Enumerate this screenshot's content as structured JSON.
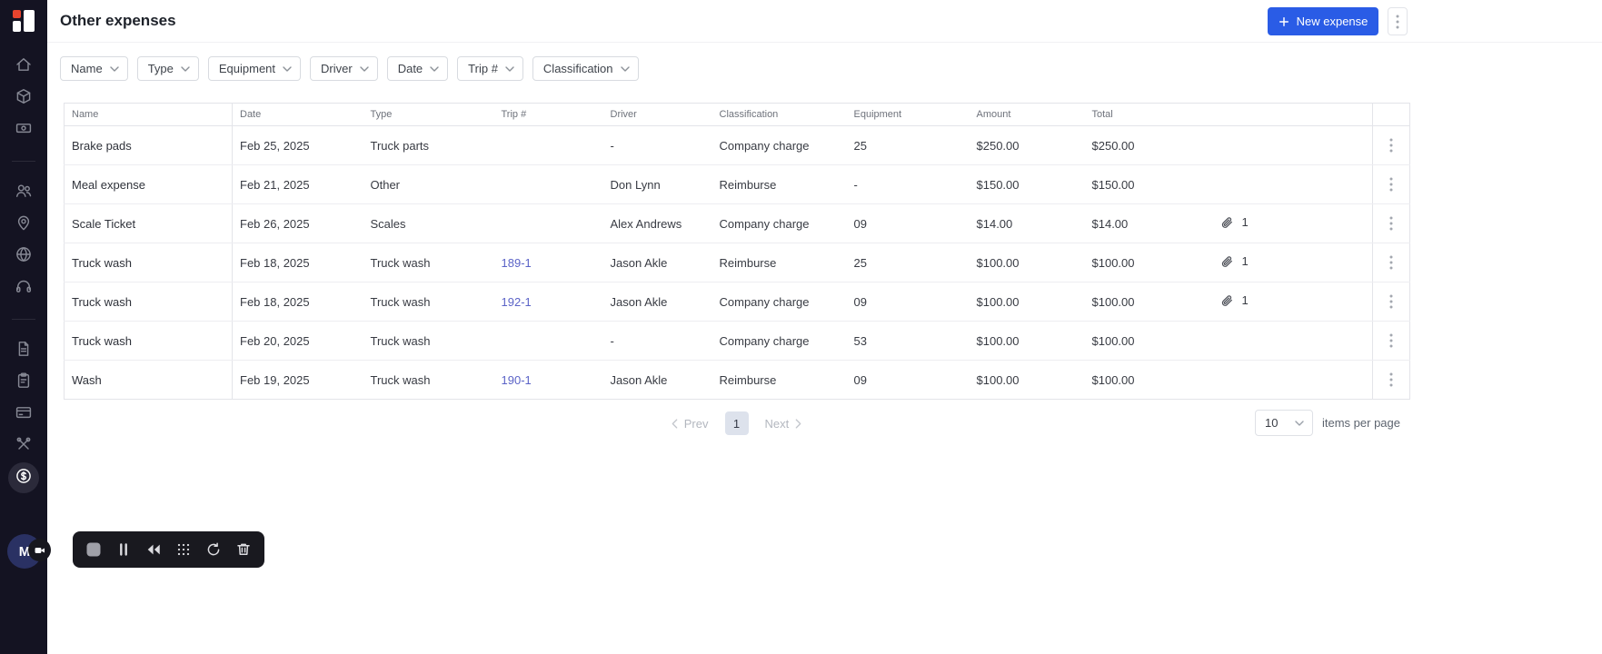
{
  "colors": {
    "accent_blue": "#2a5ce6",
    "link_indigo": "#5b63c7",
    "sidebar_bg": "#141322",
    "active_page_bg": "#dde2ec"
  },
  "header": {
    "title": "Other expenses",
    "new_expense_label": "New expense"
  },
  "filters": [
    {
      "label": "Name"
    },
    {
      "label": "Type"
    },
    {
      "label": "Equipment"
    },
    {
      "label": "Driver"
    },
    {
      "label": "Date"
    },
    {
      "label": "Trip #"
    },
    {
      "label": "Classification"
    }
  ],
  "sidebar": {
    "avatar_initial": "M",
    "items": [
      {
        "icon": "home",
        "name": "home"
      },
      {
        "icon": "box",
        "name": "inventory"
      },
      {
        "icon": "cash",
        "name": "transactions"
      },
      {
        "type": "divider"
      },
      {
        "icon": "users",
        "name": "contacts"
      },
      {
        "icon": "pin",
        "name": "locations"
      },
      {
        "icon": "globe",
        "name": "network"
      },
      {
        "icon": "headset",
        "name": "support"
      },
      {
        "type": "divider"
      },
      {
        "icon": "file",
        "name": "documents"
      },
      {
        "icon": "clipboard",
        "name": "orders"
      },
      {
        "icon": "card",
        "name": "payments"
      },
      {
        "icon": "tools",
        "name": "maintenance"
      },
      {
        "icon": "dollar",
        "name": "other-expenses",
        "active": true
      }
    ]
  },
  "table": {
    "columns": [
      "Name",
      "Date",
      "Type",
      "Trip #",
      "Driver",
      "Classification",
      "Equipment",
      "Amount",
      "Total"
    ],
    "rows": [
      {
        "name": "Brake pads",
        "date": "Feb 25, 2025",
        "type": "Truck parts",
        "trip": "",
        "driver": "-",
        "classification": "Company charge",
        "equipment": "25",
        "amount": "$250.00",
        "total": "$250.00",
        "attachments": ""
      },
      {
        "name": "Meal expense",
        "date": "Feb 21, 2025",
        "type": "Other",
        "trip": "",
        "driver": "Don Lynn",
        "classification": "Reimburse",
        "equipment": "-",
        "amount": "$150.00",
        "total": "$150.00",
        "attachments": ""
      },
      {
        "name": "Scale Ticket",
        "date": "Feb 26, 2025",
        "type": "Scales",
        "trip": "",
        "driver": "Alex Andrews",
        "classification": "Company charge",
        "equipment": "09",
        "amount": "$14.00",
        "total": "$14.00",
        "attachments": "1"
      },
      {
        "name": "Truck wash",
        "date": "Feb 18, 2025",
        "type": "Truck wash",
        "trip": "189-1",
        "driver": "Jason Akle",
        "classification": "Reimburse",
        "equipment": "25",
        "amount": "$100.00",
        "total": "$100.00",
        "attachments": "1"
      },
      {
        "name": "Truck wash",
        "date": "Feb 18, 2025",
        "type": "Truck wash",
        "trip": "192-1",
        "driver": "Jason Akle",
        "classification": "Company charge",
        "equipment": "09",
        "amount": "$100.00",
        "total": "$100.00",
        "attachments": "1"
      },
      {
        "name": "Truck wash",
        "date": "Feb 20, 2025",
        "type": "Truck wash",
        "trip": "",
        "driver": "-",
        "classification": "Company charge",
        "equipment": "53",
        "amount": "$100.00",
        "total": "$100.00",
        "attachments": ""
      },
      {
        "name": "Wash",
        "date": "Feb 19, 2025",
        "type": "Truck wash",
        "trip": "190-1",
        "driver": "Jason Akle",
        "classification": "Reimburse",
        "equipment": "09",
        "amount": "$100.00",
        "total": "$100.00",
        "attachments": ""
      }
    ]
  },
  "pagination": {
    "prev_label": "Prev",
    "next_label": "Next",
    "current": "1",
    "page_size": "10",
    "per_page_label": "items per page"
  },
  "recorder": {
    "buttons": [
      {
        "icon": "stop",
        "name": "stop-recording"
      },
      {
        "icon": "pause",
        "name": "pause-recording"
      },
      {
        "icon": "rewind",
        "name": "rewind-recording"
      },
      {
        "icon": "grid",
        "name": "grid-options"
      },
      {
        "icon": "restart",
        "name": "restart-recording"
      },
      {
        "icon": "trash",
        "name": "discard-recording"
      }
    ]
  }
}
